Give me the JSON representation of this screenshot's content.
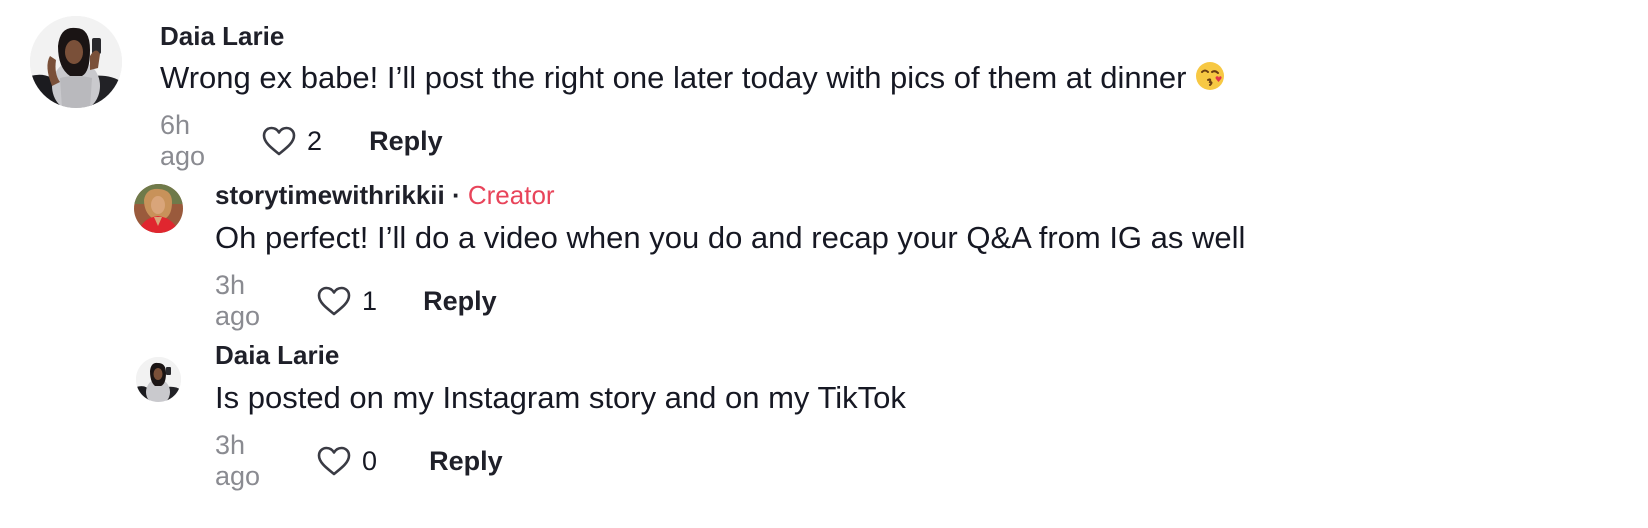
{
  "comments": [
    {
      "username": "Daia Larie",
      "text": "Wrong ex babe! I’ll post the right one later today with pics of them at dinner",
      "emoji": "kissing-face-icon",
      "time": "6h ago",
      "likes": "2",
      "reply_label": "Reply"
    },
    {
      "username": "storytimewithrikkii",
      "separator": "·",
      "badge": "Creator",
      "text": "Oh perfect! I’ll do a video when you do and recap your Q&A from IG as well",
      "time": "3h ago",
      "likes": "1",
      "reply_label": "Reply"
    },
    {
      "username": "Daia Larie",
      "text": "Is posted on my Instagram story and on my TikTok",
      "time": "3h ago",
      "likes": "0",
      "reply_label": "Reply"
    }
  ],
  "colors": {
    "creator_badge": "#e8445a",
    "timestamp": "#8a8b91",
    "text": "#161823"
  }
}
